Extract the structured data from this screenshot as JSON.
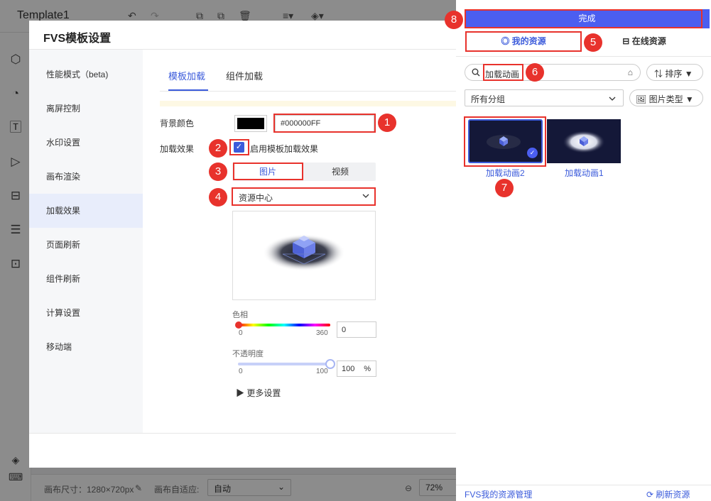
{
  "app": {
    "title": "Template1",
    "bottom": {
      "canvas_size": "画布尺寸：1280×720px",
      "autofit_label": "画布自适应:",
      "autofit_value": "自动",
      "zoom": "72%"
    }
  },
  "dialog": {
    "title": "FVS模板设置",
    "nav": [
      "性能模式（beta)",
      "离屏控制",
      "水印设置",
      "画布渲染",
      "加载效果",
      "页面刷新",
      "组件刷新",
      "计算设置",
      "移动端"
    ],
    "tabs": [
      "模板加载",
      "组件加载"
    ],
    "bg_color_label": "背景颜色",
    "bg_color_value": "#000000FF",
    "load_effect_label": "加载效果",
    "enable_label": "启用模板加载效果",
    "seg": [
      "图片",
      "视频"
    ],
    "source": "资源中心",
    "hue_label": "色相",
    "hue_min": "0",
    "hue_max": "360",
    "hue_value": "0",
    "opacity_label": "不透明度",
    "opacity_min": "0",
    "opacity_max": "100",
    "opacity_value": "100",
    "opacity_unit": "%",
    "more": "更多设置"
  },
  "panel": {
    "done": "完成",
    "tab_mine": "我的资源",
    "tab_online": "在线资源",
    "search_value": "加载动画",
    "sort": "排序",
    "group": "所有分组",
    "type": "图片类型",
    "items": [
      "加载动画2",
      "加载动画1"
    ],
    "manage": "FVS我的资源管理",
    "refresh": "刷新资源"
  },
  "callouts": [
    "1",
    "2",
    "3",
    "4",
    "5",
    "6",
    "7",
    "8"
  ],
  "colors": {
    "accent": "#3b5bdb",
    "done_button": "#4b5ef0",
    "callout": "#e8322c"
  },
  "icons": {
    "undo": "undo-icon",
    "redo": "redo-icon",
    "search": "search-icon",
    "check": "check-icon",
    "chevron": "chevron-down-icon"
  }
}
